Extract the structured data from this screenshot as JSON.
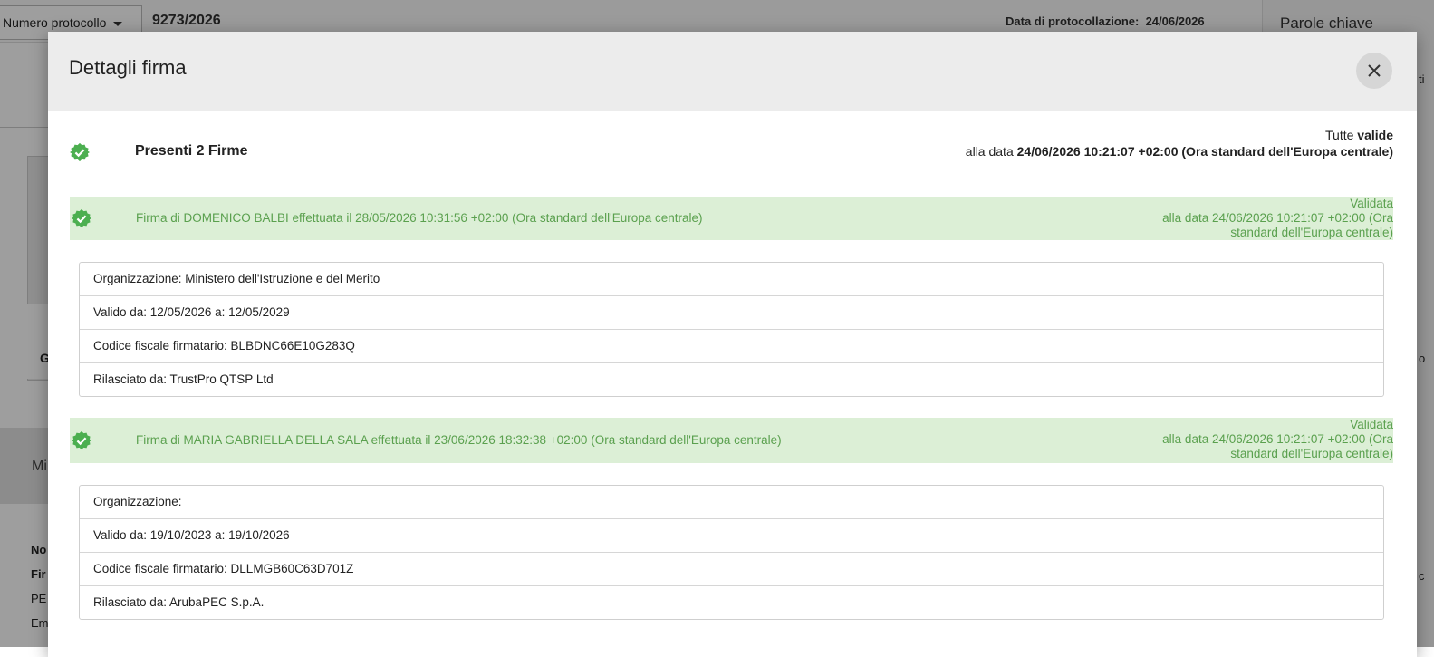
{
  "background": {
    "protocol_select_label": "Numero protocollo",
    "protocol_number": "9273/2026",
    "protocol_date_label": "Data di protocollazione:",
    "protocol_date_value": "24/06/2026",
    "keywords_label": "Parole chiave",
    "card_fragment": "G",
    "band_fragment": "Mi",
    "left_frag_1": "No",
    "left_frag_2": "Fir",
    "left_frag_3": "PE",
    "left_frag_4": "Em",
    "right_frag_1": "ti",
    "right_frag_2": "o",
    "right_frag_3": "c"
  },
  "modal": {
    "title": "Dettagli firma",
    "close_icon": "close-icon",
    "summary": {
      "title": "Presenti 2 Firme",
      "status_prefix": "Tutte",
      "status_value": "valide",
      "date_prefix": "alla data",
      "date_value": "24/06/2026 10:21:07 +02:00 (Ora standard dell'Europa centrale)"
    },
    "signatures": [
      {
        "header_text": "Firma di  DOMENICO BALBI effettuata il  28/05/2026 10:31:56 +02:00 (Ora standard dell'Europa centrale)",
        "status_line1": "Validata",
        "status_line2": "alla data 24/06/2026 10:21:07 +02:00 (Ora",
        "status_line3": "standard dell'Europa centrale)",
        "details": [
          "Organizzazione: Ministero dell'Istruzione e del Merito",
          "Valido da: 12/05/2026 a: 12/05/2029",
          "Codice fiscale firmatario: BLBDNC66E10G283Q",
          "Rilasciato da: TrustPro QTSP Ltd"
        ]
      },
      {
        "header_text": "Firma di  MARIA GABRIELLA DELLA SALA effettuata il  23/06/2026 18:32:38 +02:00 (Ora standard dell'Europa centrale)",
        "status_line1": "Validata",
        "status_line2": "alla data 24/06/2026 10:21:07 +02:00 (Ora",
        "status_line3": "standard dell'Europa centrale)",
        "details": [
          "Organizzazione:",
          "Valido da: 19/10/2023 a: 19/10/2026",
          "Codice fiscale firmatario: DLLMGB60C63D701Z",
          "Rilasciato da: ArubaPEC S.p.A."
        ]
      }
    ]
  },
  "colors": {
    "valid_green": "#5aa04e",
    "valid_bg": "#dcefd6",
    "check_fill": "#4caf50"
  }
}
